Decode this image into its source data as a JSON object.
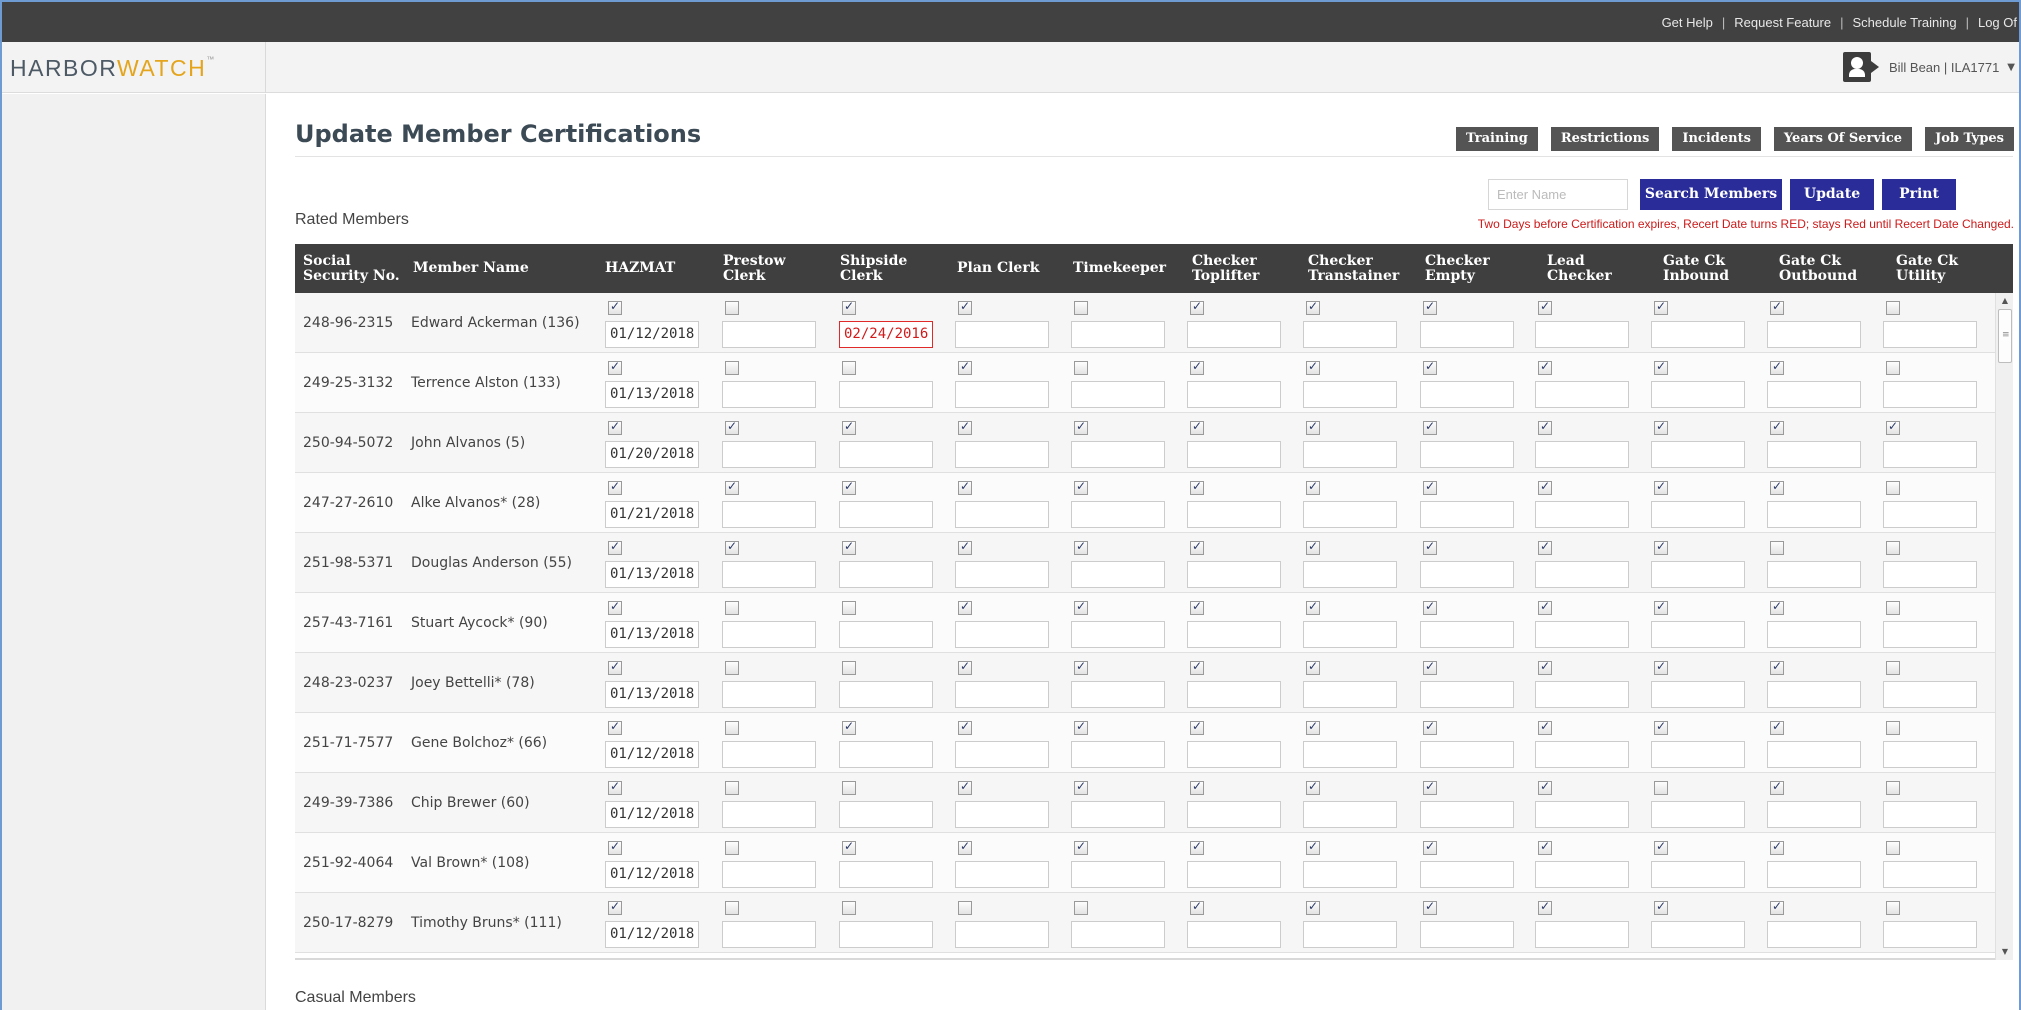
{
  "topbar": {
    "links": [
      "Get Help",
      "Request Feature",
      "Schedule Training",
      "Log Of"
    ]
  },
  "brand": {
    "part1": "HARBOR",
    "part2": "WATCH",
    "tm": "™",
    "accent_color": "#e4a51c",
    "primary_color": "#4d5a66"
  },
  "user": {
    "label": "Bill Bean | ILA1771",
    "icon": "user-profile-icon"
  },
  "page": {
    "title": "Update Member Certifications"
  },
  "nav_buttons": [
    "Training",
    "Restrictions",
    "Incidents",
    "Years Of Service",
    "Job Types"
  ],
  "search": {
    "placeholder": "Enter Name",
    "value": ""
  },
  "actions": {
    "search_members": "Search Members",
    "update": "Update",
    "print": "Print",
    "button_color": "#2a2c9a"
  },
  "rated": {
    "section_title": "Rated Members",
    "note": "Two Days before Certification expires, Recert Date turns RED; stays Red until Recert Date Changed.",
    "note_color": "#cc1a1a",
    "columns": [
      "Social Security No.",
      "Member Name",
      "HAZMAT",
      "Prestow Clerk",
      "Shipside Clerk",
      "Plan Clerk",
      "Timekeeper",
      "Checker Toplifter",
      "Checker Transtainer",
      "Checker Empty",
      "Lead Checker",
      "Gate Ck Inbound",
      "Gate Ck Outbound",
      "Gate Ck Utility"
    ],
    "rows": [
      {
        "ssn": "248-96-2315",
        "name": "Edward Ackerman (136)",
        "checks": [
          true,
          false,
          true,
          true,
          false,
          true,
          true,
          true,
          true,
          true,
          true,
          false
        ],
        "dates": [
          "01/12/2018",
          "",
          "02/24/2016",
          "",
          "",
          "",
          "",
          "",
          "",
          "",
          "",
          ""
        ],
        "red_date": 2
      },
      {
        "ssn": "249-25-3132",
        "name": "Terrence Alston (133)",
        "checks": [
          true,
          false,
          false,
          true,
          false,
          true,
          true,
          true,
          true,
          true,
          true,
          false
        ],
        "dates": [
          "01/13/2018",
          "",
          "",
          "",
          "",
          "",
          "",
          "",
          "",
          "",
          "",
          ""
        ],
        "red_date": -1
      },
      {
        "ssn": "250-94-5072",
        "name": "John Alvanos (5)",
        "checks": [
          true,
          true,
          true,
          true,
          true,
          true,
          true,
          true,
          true,
          true,
          true,
          true
        ],
        "dates": [
          "01/20/2018",
          "",
          "",
          "",
          "",
          "",
          "",
          "",
          "",
          "",
          "",
          ""
        ],
        "red_date": -1
      },
      {
        "ssn": "247-27-2610",
        "name": "Alke Alvanos* (28)",
        "checks": [
          true,
          true,
          true,
          true,
          true,
          true,
          true,
          true,
          true,
          true,
          true,
          false
        ],
        "dates": [
          "01/21/2018",
          "",
          "",
          "",
          "",
          "",
          "",
          "",
          "",
          "",
          "",
          ""
        ],
        "red_date": -1
      },
      {
        "ssn": "251-98-5371",
        "name": "Douglas  Anderson (55)",
        "checks": [
          true,
          true,
          true,
          true,
          true,
          true,
          true,
          true,
          true,
          true,
          false,
          false
        ],
        "dates": [
          "01/13/2018",
          "",
          "",
          "",
          "",
          "",
          "",
          "",
          "",
          "",
          "",
          ""
        ],
        "red_date": -1
      },
      {
        "ssn": "257-43-7161",
        "name": "Stuart Aycock* (90)",
        "checks": [
          true,
          false,
          false,
          true,
          true,
          true,
          true,
          true,
          true,
          true,
          true,
          false
        ],
        "dates": [
          "01/13/2018",
          "",
          "",
          "",
          "",
          "",
          "",
          "",
          "",
          "",
          "",
          ""
        ],
        "red_date": -1
      },
      {
        "ssn": "248-23-0237",
        "name": "Joey Bettelli* (78)",
        "checks": [
          true,
          false,
          false,
          true,
          true,
          true,
          true,
          true,
          true,
          true,
          true,
          false
        ],
        "dates": [
          "01/13/2018",
          "",
          "",
          "",
          "",
          "",
          "",
          "",
          "",
          "",
          "",
          ""
        ],
        "red_date": -1
      },
      {
        "ssn": "251-71-7577",
        "name": "Gene Bolchoz* (66)",
        "checks": [
          true,
          false,
          true,
          true,
          true,
          true,
          true,
          true,
          true,
          true,
          true,
          false
        ],
        "dates": [
          "01/12/2018",
          "",
          "",
          "",
          "",
          "",
          "",
          "",
          "",
          "",
          "",
          ""
        ],
        "red_date": -1
      },
      {
        "ssn": "249-39-7386",
        "name": "Chip Brewer (60)",
        "checks": [
          true,
          false,
          false,
          true,
          true,
          true,
          true,
          true,
          true,
          false,
          true,
          false
        ],
        "dates": [
          "01/12/2018",
          "",
          "",
          "",
          "",
          "",
          "",
          "",
          "",
          "",
          "",
          ""
        ],
        "red_date": -1
      },
      {
        "ssn": "251-92-4064",
        "name": "Val Brown* (108)",
        "checks": [
          true,
          false,
          true,
          true,
          true,
          true,
          true,
          true,
          true,
          true,
          true,
          false
        ],
        "dates": [
          "01/12/2018",
          "",
          "",
          "",
          "",
          "",
          "",
          "",
          "",
          "",
          "",
          ""
        ],
        "red_date": -1
      },
      {
        "ssn": "250-17-8279",
        "name": "Timothy Bruns* (111)",
        "checks": [
          true,
          false,
          false,
          false,
          false,
          true,
          true,
          true,
          true,
          true,
          true,
          false
        ],
        "dates": [
          "01/12/2018",
          "",
          "",
          "",
          "",
          "",
          "",
          "",
          "",
          "",
          "",
          ""
        ],
        "red_date": -1
      }
    ]
  },
  "casual": {
    "section_title": "Casual Members"
  }
}
